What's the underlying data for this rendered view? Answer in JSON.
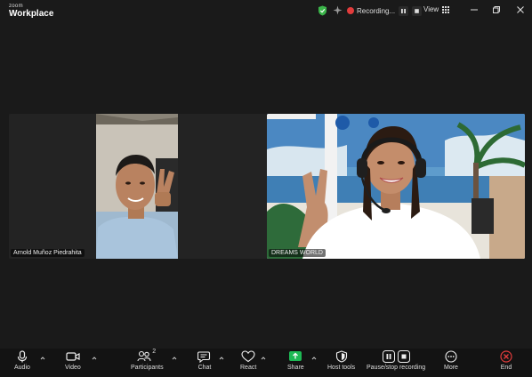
{
  "titlebar": {
    "brand_top": "zoom",
    "brand_bottom": "Workplace",
    "recording_label": "Recording...",
    "view_label": "View"
  },
  "participants": [
    {
      "name": "Arnold Muñoz Piedrahita"
    },
    {
      "name": "DREAMS WORLD"
    }
  ],
  "toolbar": {
    "audio": "Audio",
    "video": "Video",
    "participants": "Participants",
    "participants_count": "2",
    "chat": "Chat",
    "react": "React",
    "share": "Share",
    "host_tools": "Host tools",
    "pause_stop_recording": "Pause/stop recording",
    "more": "More",
    "end": "End"
  },
  "colors": {
    "share_green": "#1db954",
    "end_red": "#e23c3c",
    "shield_green": "#3bb54a",
    "record_red": "#e23c3c"
  }
}
